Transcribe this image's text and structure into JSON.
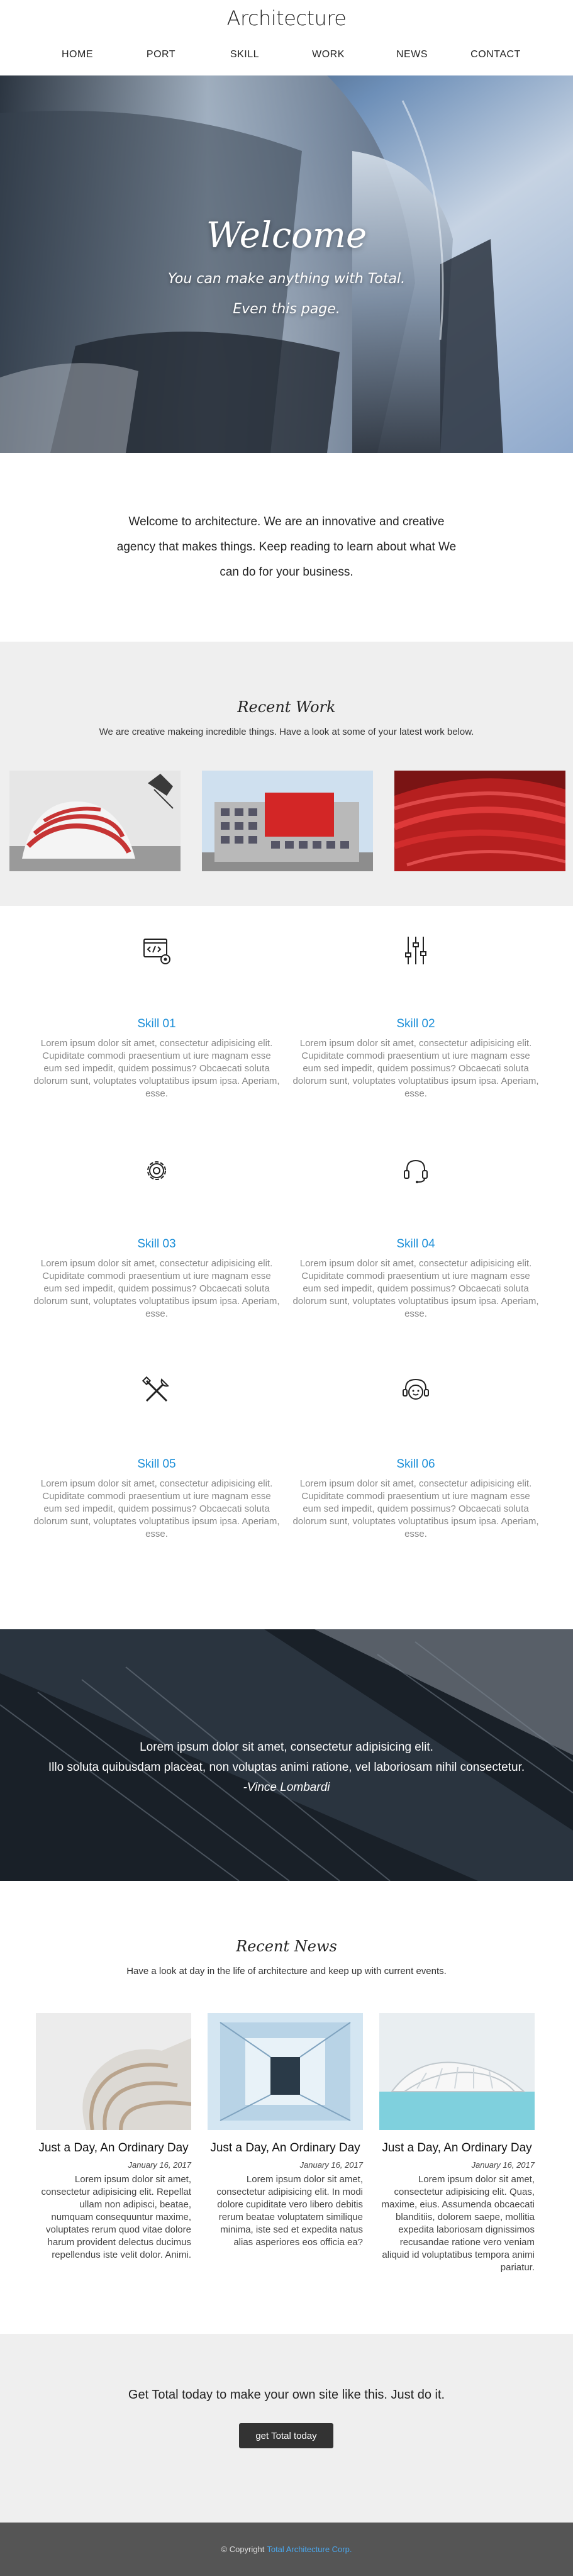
{
  "header": {
    "logo": "Architecture",
    "nav": [
      "HOME",
      "PORT",
      "SKILL",
      "WORK",
      "NEWS",
      "CONTACT"
    ]
  },
  "hero": {
    "title": "Welcome",
    "subtitle_line1": "You can make anything with Total.",
    "subtitle_line2": "Even this page."
  },
  "intro": {
    "text": "Welcome to architecture. We are an innovative and creative agency that makes things. Keep reading to learn about what We can do for your business."
  },
  "work": {
    "title": "Recent Work",
    "description": "We are creative makeing incredible things. Have a look at some of your latest work below."
  },
  "skills": [
    {
      "title": "Skill 01",
      "icon": "code-settings-icon",
      "text": "Lorem ipsum dolor sit amet, consectetur adipisicing elit. Cupiditate commodi praesentium ut iure magnam esse eum sed impedit, quidem possimus? Obcaecati soluta dolorum sunt, voluptates voluptatibus ipsum ipsa. Aperiam, esse."
    },
    {
      "title": "Skill 02",
      "icon": "sliders-icon",
      "text": "Lorem ipsum dolor sit amet, consectetur adipisicing elit. Cupiditate commodi praesentium ut iure magnam esse eum sed impedit, quidem possimus? Obcaecati soluta dolorum sunt, voluptates voluptatibus ipsum ipsa. Aperiam, esse."
    },
    {
      "title": "Skill 03",
      "icon": "gear-icon",
      "text": "Lorem ipsum dolor sit amet, consectetur adipisicing elit. Cupiditate commodi praesentium ut iure magnam esse eum sed impedit, quidem possimus? Obcaecati soluta dolorum sunt, voluptates voluptatibus ipsum ipsa. Aperiam, esse."
    },
    {
      "title": "Skill 04",
      "icon": "headset-icon",
      "text": "Lorem ipsum dolor sit amet, consectetur adipisicing elit. Cupiditate commodi praesentium ut iure magnam esse eum sed impedit, quidem possimus? Obcaecati soluta dolorum sunt, voluptates voluptatibus ipsum ipsa. Aperiam, esse."
    },
    {
      "title": "Skill 05",
      "icon": "tools-icon",
      "text": "Lorem ipsum dolor sit amet, consectetur adipisicing elit. Cupiditate commodi praesentium ut iure magnam esse eum sed impedit, quidem possimus? Obcaecati soluta dolorum sunt, voluptates voluptatibus ipsum ipsa. Aperiam, esse."
    },
    {
      "title": "Skill 06",
      "icon": "support-icon",
      "text": "Lorem ipsum dolor sit amet, consectetur adipisicing elit. Cupiditate commodi praesentium ut iure magnam esse eum sed impedit, quidem possimus? Obcaecati soluta dolorum sunt, voluptates voluptatibus ipsum ipsa. Aperiam, esse."
    }
  ],
  "quote": {
    "line1": "Lorem ipsum dolor sit amet, consectetur adipisicing elit.",
    "line2": "Illo soluta quibusdam placeat, non voluptas animi ratione, vel laboriosam nihil consectetur.",
    "author": "-Vince Lombardi"
  },
  "news": {
    "title": "Recent News",
    "description": "Have a look at day in the life of architecture and keep up with current events.",
    "items": [
      {
        "title": "Just a Day, An Ordinary Day",
        "date": "January 16, 2017",
        "text": "Lorem ipsum dolor sit amet, consectetur adipisicing elit. Repellat ullam non adipisci, beatae, numquam consequuntur maxime, voluptates rerum quod vitae dolore harum provident delectus ducimus repellendus iste velit dolor. Animi."
      },
      {
        "title": "Just a Day, An Ordinary Day",
        "date": "January 16, 2017",
        "text": "Lorem ipsum dolor sit amet, consectetur adipisicing elit. In modi dolore cupiditate vero libero debitis rerum beatae voluptatem similique minima, iste sed et expedita natus alias asperiores eos officia ea?"
      },
      {
        "title": "Just a Day, An Ordinary Day",
        "date": "January 16, 2017",
        "text": "Lorem ipsum dolor sit amet, consectetur adipisicing elit. Quas, maxime, eius. Assumenda obcaecati blanditiis, dolorem saepe, mollitia expedita laboriosam dignissimos recusandae ratione vero veniam aliquid id voluptatibus tempora animi pariatur."
      }
    ]
  },
  "cta": {
    "text": "Get Total today to make your own site like this. Just do it.",
    "button": "get Total today"
  },
  "footer": {
    "copyright": "© Copyright",
    "link": "Total Architecture Corp."
  },
  "colors": {
    "accent": "#1a8ed8",
    "footer_bg": "#555555",
    "section_bg": "#efefef",
    "button_bg": "#333333"
  }
}
